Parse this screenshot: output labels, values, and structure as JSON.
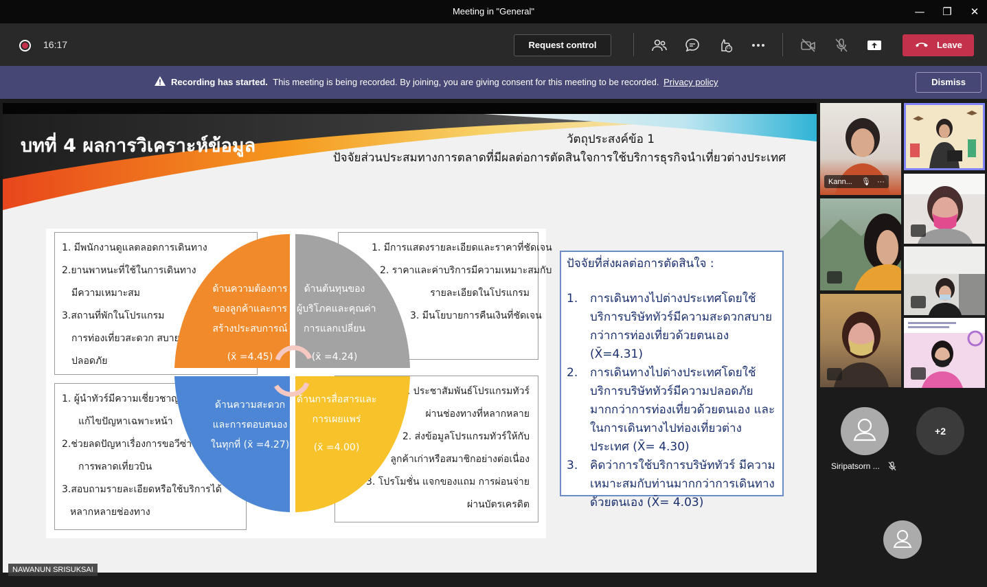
{
  "window": {
    "title": "Meeting in \"General\"",
    "controls": {
      "minimize": "—",
      "maximize": "❐",
      "close": "✕"
    }
  },
  "toolbar": {
    "recording_icon": "record-dot",
    "timer": "16:17",
    "request_control": "Request control",
    "icons": [
      "people-icon",
      "chat-icon",
      "reactions-icon",
      "more-icon",
      "camera-off-icon",
      "mic-off-icon",
      "share-icon"
    ],
    "leave": "Leave",
    "leave_color": "#c4314b"
  },
  "banner": {
    "bold": "Recording has started.",
    "message": "This meeting is being recorded. By joining, you are giving consent for this meeting to be recorded.",
    "link": "Privacy policy",
    "dismiss": "Dismiss",
    "color": "#464775"
  },
  "slide": {
    "title": "บทที่ 4 ผลการวิเคราะห์ข้อมูล",
    "objective": "วัตถุประสงค์ข้อ 1",
    "subtitle": "ปัจจัยส่วนประสมทางการตลาดที่มีผลต่อการตัดสินใจการใช้บริการธุรกิจนำเที่ยวต่างประเทศ",
    "boxes": {
      "top_left": [
        "1. มีพนักงานดูแลตลอดการเดินทาง",
        "2.ยานพาหนะที่ใช้ในการเดินทาง",
        "มีความเหมาะสม",
        "3.สถานที่พักในโปรแกรม",
        "การท่องเที่ยวสะดวก สบาย",
        "ปลอดภัย"
      ],
      "top_right": [
        "1.     มีการแสดงรายละเอียดและราคาที่ชัดเจน",
        "2.     ราคาและค่าบริการมีความเหมาะสมกับ",
        "รายละเอียดในโปรแกรม",
        "3.     มีนโยบายการคืนเงินที่ชัดเจน"
      ],
      "bottom_left": [
        "1. ผู้นำทัวร์มีความเชี่ยวชาญและ",
        "แก้ไขปัญหาเฉพาะหน้า",
        "2.ช่วยลดปัญหาเรื่องการขอวีซ่า",
        "การพลาดเที่ยวบิน",
        "3.สอบถามรายละเอียดหรือใช้บริการได้",
        "หลากหลายช่องทาง"
      ],
      "bottom_right": [
        "1.  ประชาสัมพันธ์โปรแกรมทัวร์",
        "ผ่านช่องทางที่หลากหลาย",
        "2.  ส่งข้อมูลโปรแกรมทัวร์ให้กับ",
        "ลูกค้าเก่าหรือสมาชิกอย่างต่อเนื่อง",
        "3.  โปรโมชั่น แจกของแถม การผ่อนจ่าย",
        "ผ่านบัตรเครดิต"
      ]
    },
    "quadrants": {
      "orange": {
        "lines": [
          "ด้านความต้องการ",
          "ของลูกค้าและการ",
          "สร้างประสบการณ์"
        ],
        "score": "(x̄ =4.45)",
        "color": "#f08a2b"
      },
      "gray": {
        "lines": [
          "ด้านต้นทุนของ",
          "ผู้บริโภคและคุณค่า",
          "การแลกเปลี่ยน"
        ],
        "score": "(x̄ =4.24)",
        "color": "#a3a3a3"
      },
      "blue": {
        "lines": [
          "ด้านความสะดวก",
          "และการตอบสนอง",
          "ในทุกที่ (x̄ =4.27)"
        ],
        "color": "#4d86d4"
      },
      "yellow": {
        "lines": [
          "ด้านการสื่อสารและ",
          "การเผยแพร่"
        ],
        "score": "(x̄ =4.00)",
        "color": "#f7c22a"
      }
    },
    "factors": {
      "heading": "ปัจจัยที่ส่งผลต่อการตัดสินใจ :",
      "items": [
        {
          "num": "1.",
          "text": "การเดินทางไปต่างประเทศโดยใช้บริการบริษัททัวร์มีความสะดวกสบายกว่าการท่องเที่ยวด้วยตนเอง (X̄=4.31)"
        },
        {
          "num": "2.",
          "text": "การเดินทางไปต่างประเทศโดยใช้บริการบริษัททัวร์มีความปลอดภัยมากกว่าการท่องเที่ยวด้วยตนเอง และในการเดินทางไปท่องเที่ยวต่างประเทศ (X̄= 4.30)"
        },
        {
          "num": "3.",
          "text": "คิดว่าการใช้บริการบริษัททัวร์ มีความเหมาะสมกับท่านมากกว่าการเดินทางด้วยตนเอง (X̄= 4.03)"
        }
      ]
    }
  },
  "presenter": {
    "name": "NAWANUN SRISUKSAI"
  },
  "gallery": {
    "tile1_label": "Kann...",
    "tile1_more": "···",
    "participant_name": "Siripatsorn ...",
    "more_count": "+2"
  }
}
